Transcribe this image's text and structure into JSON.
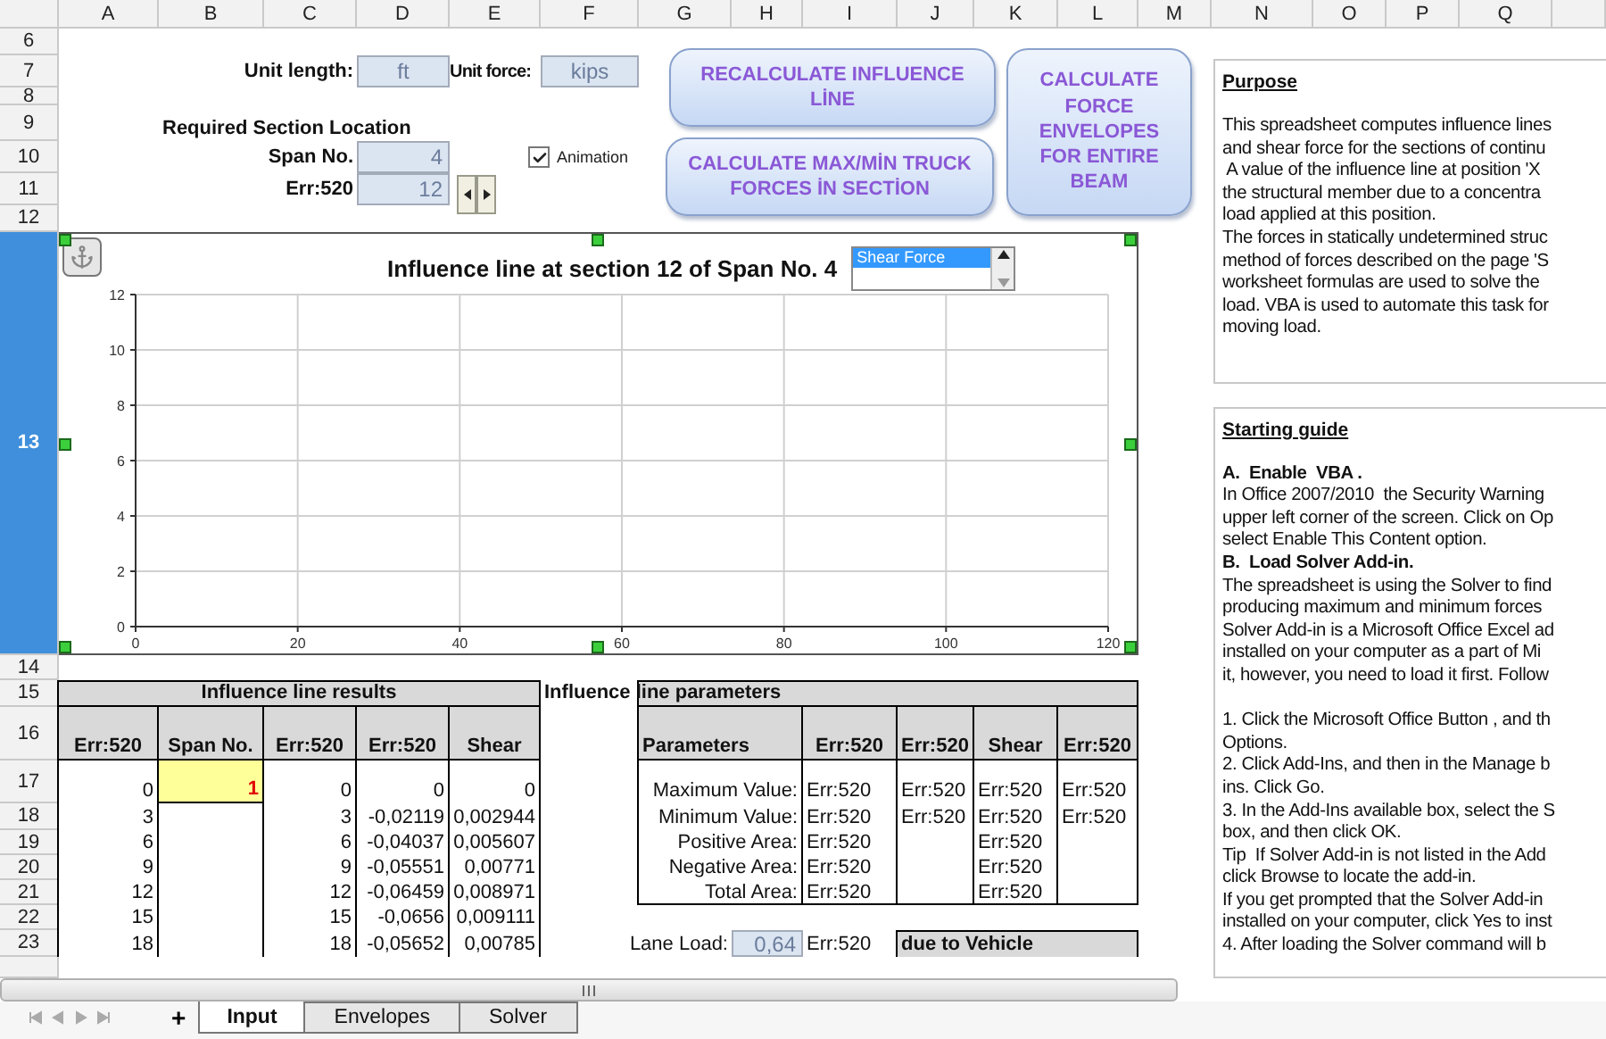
{
  "column_headers": [
    "A",
    "B",
    "C",
    "D",
    "E",
    "F",
    "G",
    "H",
    "I",
    "J",
    "K",
    "L",
    "M",
    "N",
    "O",
    "P",
    "Q"
  ],
  "row_headers": [
    {
      "label": "6",
      "selected": false
    },
    {
      "label": "7",
      "selected": false
    },
    {
      "label": "8",
      "selected": false
    },
    {
      "label": "9",
      "selected": false
    },
    {
      "label": "10",
      "selected": false
    },
    {
      "label": "11",
      "selected": false
    },
    {
      "label": "12",
      "selected": false
    },
    {
      "label": "13",
      "selected": true
    },
    {
      "label": "14",
      "selected": false
    },
    {
      "label": "15",
      "selected": false
    },
    {
      "label": "16",
      "selected": false
    },
    {
      "label": "17",
      "selected": false
    },
    {
      "label": "18",
      "selected": false
    },
    {
      "label": "19",
      "selected": false
    },
    {
      "label": "20",
      "selected": false
    },
    {
      "label": "21",
      "selected": false
    },
    {
      "label": "22",
      "selected": false
    },
    {
      "label": "23",
      "selected": false
    }
  ],
  "units": {
    "length_label": "Unit length:",
    "length_value": "ft",
    "force_label": "Unit force:",
    "force_value": "kips"
  },
  "section": {
    "title": "Required Section Location",
    "span_label": "Span No.",
    "span_value": "4",
    "position_label": "Err:520",
    "position_value": "12"
  },
  "animation": {
    "label": "Animation",
    "checked": true
  },
  "buttons": [
    "RECALCULATE INFLUENCE LİNE",
    "CALCULATE MAX/MİN TRUCK FORCES İN SECTİON",
    "CALCULATE FORCE ENVELOPES FOR ENTIRE BEAM"
  ],
  "chart": {
    "selected": true,
    "series_picker": [
      {
        "label": "Shear Force",
        "selected": true
      }
    ],
    "chart_data": {
      "type": "line",
      "grid": true,
      "title": "Influence line at section 12 of Span No. 4",
      "xlim": [
        0,
        120
      ],
      "ylim": [
        0,
        12
      ],
      "xticks": [
        0,
        20,
        40,
        60,
        80,
        100,
        120
      ],
      "yticks": [
        0,
        2,
        4,
        6,
        8,
        10,
        12
      ]
    }
  },
  "results": {
    "title": "Influence line results",
    "columns": [
      {
        "label": "Err:520",
        "kind": "value"
      },
      {
        "label": "Span No.",
        "kind": "span"
      },
      {
        "label": "Err:520",
        "kind": "value"
      },
      {
        "label": "Err:520",
        "kind": "value"
      },
      {
        "label": "Shear",
        "kind": "value"
      }
    ],
    "rows": [
      [
        "0",
        "1",
        "0",
        "0",
        "0"
      ],
      [
        "3",
        null,
        "3",
        "-0,02119",
        "0,002944"
      ],
      [
        "6",
        null,
        "6",
        "-0,04037",
        "0,005607"
      ],
      [
        "9",
        null,
        "9",
        "-0,05551",
        "0,00771"
      ],
      [
        "12",
        null,
        "12",
        "-0,06459",
        "0,008971"
      ],
      [
        "15",
        null,
        "15",
        "-0,0656",
        "0,009111"
      ],
      [
        "18",
        null,
        "18",
        "-0,05652",
        "0,00785"
      ]
    ]
  },
  "parameters": {
    "title": "Influence line parameters",
    "columns": [
      "Parameters",
      "Err:520",
      "Err:520",
      "Shear",
      "Err:520"
    ],
    "rows": [
      {
        "label": "Maximum Value:",
        "value_1": "Err:520",
        "value_2": "Err:520",
        "value_3": "Err:520",
        "value_4": "Err:520"
      },
      {
        "label": "Minimum Value:",
        "value_1": "Err:520",
        "value_2": "Err:520",
        "value_3": "Err:520",
        "value_4": "Err:520"
      },
      {
        "label": "Positive Area:",
        "value_1": "Err:520",
        "value_3": "Err:520"
      },
      {
        "label": "Negative Area:",
        "value_1": "Err:520",
        "value_3": "Err:520"
      },
      {
        "label": "Total Area:",
        "value_1": "Err:520",
        "value_3": "Err:520"
      }
    ]
  },
  "lane_load": {
    "label": "Lane Load:",
    "value": "0,64",
    "result": "Err:520",
    "header": "due to Vehicle"
  },
  "purpose": {
    "heading": "Purpose",
    "lines": [
      "This spreadsheet computes influence lines",
      "and shear force for the sections of continu",
      " A value of the influence line at position 'X",
      "the structural member due to a concentra",
      "load applied at this position.",
      "The forces in statically undetermined struc",
      "method of forces described on the page 'S",
      "worksheet formulas are used to solve the",
      "load. VBA is used to automate this task for",
      "moving load."
    ]
  },
  "guide": {
    "heading": "Starting guide",
    "lines": [
      {
        "kind": "gap"
      },
      {
        "kind": "bold",
        "text": "A.  Enable  VBA ."
      },
      {
        "kind": "text",
        "text": "In Office 2007/2010  the Security Warning"
      },
      {
        "kind": "text",
        "text": "upper left corner of the screen. Click on Op"
      },
      {
        "kind": "text",
        "text": "select Enable This Content option."
      },
      {
        "kind": "bold",
        "text": "B.  Load Solver Add-in."
      },
      {
        "kind": "text",
        "text": "The spreadsheet is using the Solver to find"
      },
      {
        "kind": "text",
        "text": "producing maximum and minimum forces"
      },
      {
        "kind": "text",
        "text": "Solver Add-in is a Microsoft Office Excel ad"
      },
      {
        "kind": "text",
        "text": "installed on your computer as a part of Mi"
      },
      {
        "kind": "text",
        "text": "it, however, you need to load it first. Follow"
      },
      {
        "kind": "gap"
      },
      {
        "kind": "text",
        "text": "1. Click the Microsoft Office Button , and th"
      },
      {
        "kind": "text",
        "text": "Options."
      },
      {
        "kind": "text",
        "text": "2. Click Add-Ins, and then in the Manage b"
      },
      {
        "kind": "text",
        "text": "ins. Click Go."
      },
      {
        "kind": "text",
        "text": "3. In the Add-Ins available box, select the S"
      },
      {
        "kind": "text",
        "text": "box, and then click OK."
      },
      {
        "kind": "text",
        "text": "Tip  If Solver Add-in is not listed in the Add"
      },
      {
        "kind": "text",
        "text": "click Browse to locate the add-in."
      },
      {
        "kind": "text",
        "text": "If you get prompted that the Solver Add-in"
      },
      {
        "kind": "text",
        "text": "installed on your computer, click Yes to inst"
      },
      {
        "kind": "text",
        "text": "4. After loading the Solver command will b"
      }
    ]
  },
  "add_sheet": "+",
  "sheet_tabs": [
    {
      "label": "Input",
      "selected": true
    },
    {
      "label": "Envelopes",
      "selected": false
    },
    {
      "label": "Solver",
      "selected": false
    }
  ]
}
